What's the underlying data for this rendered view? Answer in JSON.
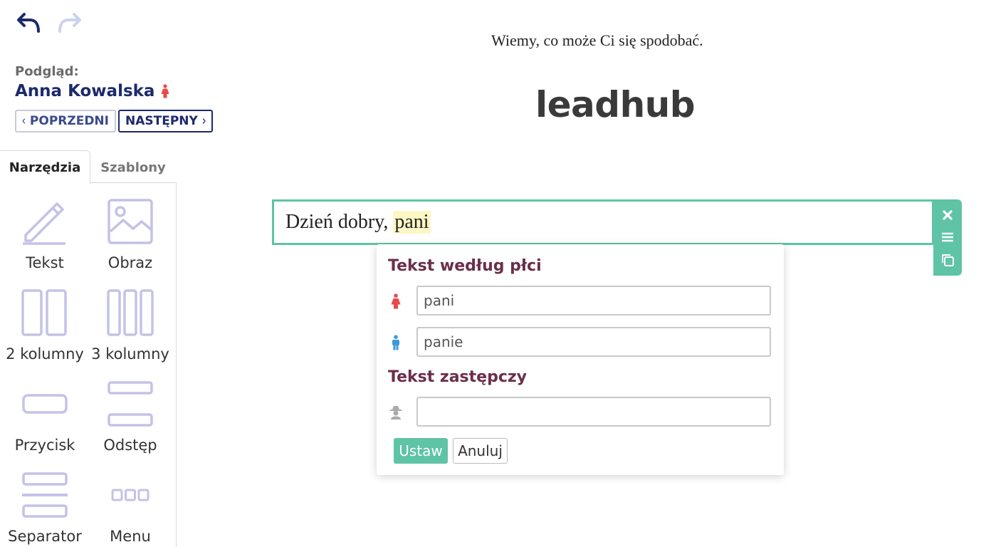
{
  "toolbar": {
    "undo_icon": "undo-icon",
    "redo_icon": "redo-icon"
  },
  "preview": {
    "label": "Podgląd:",
    "name": "Anna Kowalska",
    "gender_icon": "female-icon",
    "prev_label": "POPRZEDNI",
    "next_label": "NASTĘPNY"
  },
  "tabs": [
    {
      "label": "Narzędzia",
      "active": true
    },
    {
      "label": "Szablony",
      "active": false
    }
  ],
  "tools": [
    {
      "label": "Tekst",
      "icon": "pencil-icon"
    },
    {
      "label": "Obraz",
      "icon": "image-icon"
    },
    {
      "label": "2 kolumny",
      "icon": "two-columns-icon"
    },
    {
      "label": "3 kolumny",
      "icon": "three-columns-icon"
    },
    {
      "label": "Przycisk",
      "icon": "button-icon"
    },
    {
      "label": "Odstęp",
      "icon": "spacer-icon"
    },
    {
      "label": "Separator",
      "icon": "separator-icon"
    },
    {
      "label": "Menu",
      "icon": "menu-icon"
    }
  ],
  "email": {
    "header_text": "Wiemy, co może Ci się spodobać.",
    "logo_text": "leadhub",
    "block_text_prefix": "Dzień dobry, ",
    "block_text_highlight": "pani"
  },
  "block_tools": [
    "close-icon",
    "move-icon",
    "duplicate-icon"
  ],
  "popup": {
    "gender_title": "Tekst według płci",
    "female_value": "pani",
    "male_value": "panie",
    "fallback_title": "Tekst zastępczy",
    "fallback_value": "",
    "ok_label": "Ustaw",
    "cancel_label": "Anuluj"
  },
  "colors": {
    "accent": "#5ec4a5",
    "navy": "#1d2a6b",
    "female": "#e84a4a",
    "male": "#3a9ad9",
    "popup_heading": "#6b2f4a",
    "tool_icon": "#c4c2e6"
  }
}
